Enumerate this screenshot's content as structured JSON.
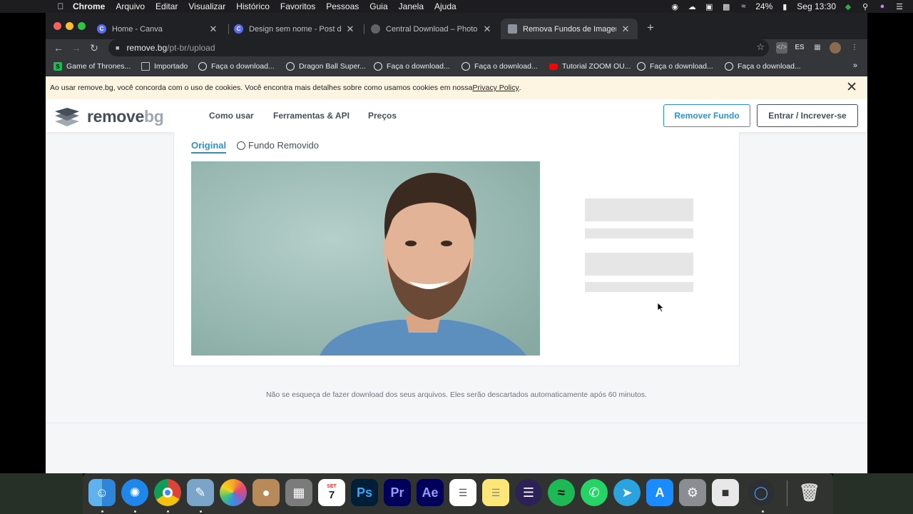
{
  "menubar": {
    "app": "Chrome",
    "items": [
      "Arquivo",
      "Editar",
      "Visualizar",
      "Histórico",
      "Favoritos",
      "Pessoas",
      "Guia",
      "Janela",
      "Ajuda"
    ],
    "battery": "24%",
    "clock": "Seg 13:30"
  },
  "tabs": [
    {
      "title": "Home - Canva",
      "favicon": "canva-icon"
    },
    {
      "title": "Design sem nome - Post do Ins",
      "favicon": "canva-icon"
    },
    {
      "title": "Central Download – Photo Can",
      "favicon": "globe-icon"
    },
    {
      "title": "Remova Fundos de Imagens – r",
      "favicon": "removebg-icon"
    }
  ],
  "address": {
    "host": "remove.bg",
    "path": "/pt-br/upload"
  },
  "bookmarks": [
    {
      "label": "Game of Thrones...",
      "icon": "s-icon"
    },
    {
      "label": "Importado",
      "icon": "folder-icon"
    },
    {
      "label": "Faça o download...",
      "icon": "globe-icon"
    },
    {
      "label": "Dragon Ball Super...",
      "icon": "globe-icon"
    },
    {
      "label": "Faça o download...",
      "icon": "globe-icon"
    },
    {
      "label": "Faça o download...",
      "icon": "globe-icon"
    },
    {
      "label": "Tutorial ZOOM OU...",
      "icon": "youtube-icon"
    },
    {
      "label": "Faça o download...",
      "icon": "globe-icon"
    },
    {
      "label": "Faça o download...",
      "icon": "globe-icon"
    }
  ],
  "bookmarks_more": "»",
  "cookie": {
    "text": "Ao usar remove.bg, você concorda com o uso de cookies. Você encontra mais detalhes sobre como usamos cookies em nossa ",
    "link": "Privacy Policy",
    "after": "."
  },
  "site": {
    "logo_a": "remove",
    "logo_b": "bg",
    "nav": [
      "Como usar",
      "Ferramentas & API",
      "Preços"
    ],
    "btn_remove": "Remover Fundo",
    "btn_login": "Entrar / Increver-se"
  },
  "result": {
    "tab_original": "Original",
    "tab_removed": "Fundo Removido"
  },
  "notice": "Não se esqueça de fazer download dos seus arquivos. Eles serão descartados automaticamente após 60 minutos.",
  "dock": [
    "finder-icon",
    "safari-icon",
    "chrome-icon",
    "preview-icon",
    "photos-icon",
    "contacts-icon",
    "calculator-icon",
    "calendar-icon",
    "photoshop-icon",
    "premiere-icon",
    "after-effects-icon",
    "reminders-icon",
    "notes-icon",
    "eclipse-icon",
    "spotify-icon",
    "whatsapp-icon",
    "telegram-icon",
    "app-store-icon",
    "system-preferences-icon",
    "roblox-icon",
    "quicktime-icon",
    "trash-icon"
  ],
  "dock_labels": {
    "calendar_month": "SET",
    "calendar_day": "7",
    "ps": "Ps",
    "pr": "Pr",
    "ae": "Ae"
  },
  "colors": {
    "accent": "#2d93c8",
    "logo_dark": "#454f5b",
    "logo_light": "#a0a8b1",
    "cookie_bg": "#fdf4e1"
  }
}
